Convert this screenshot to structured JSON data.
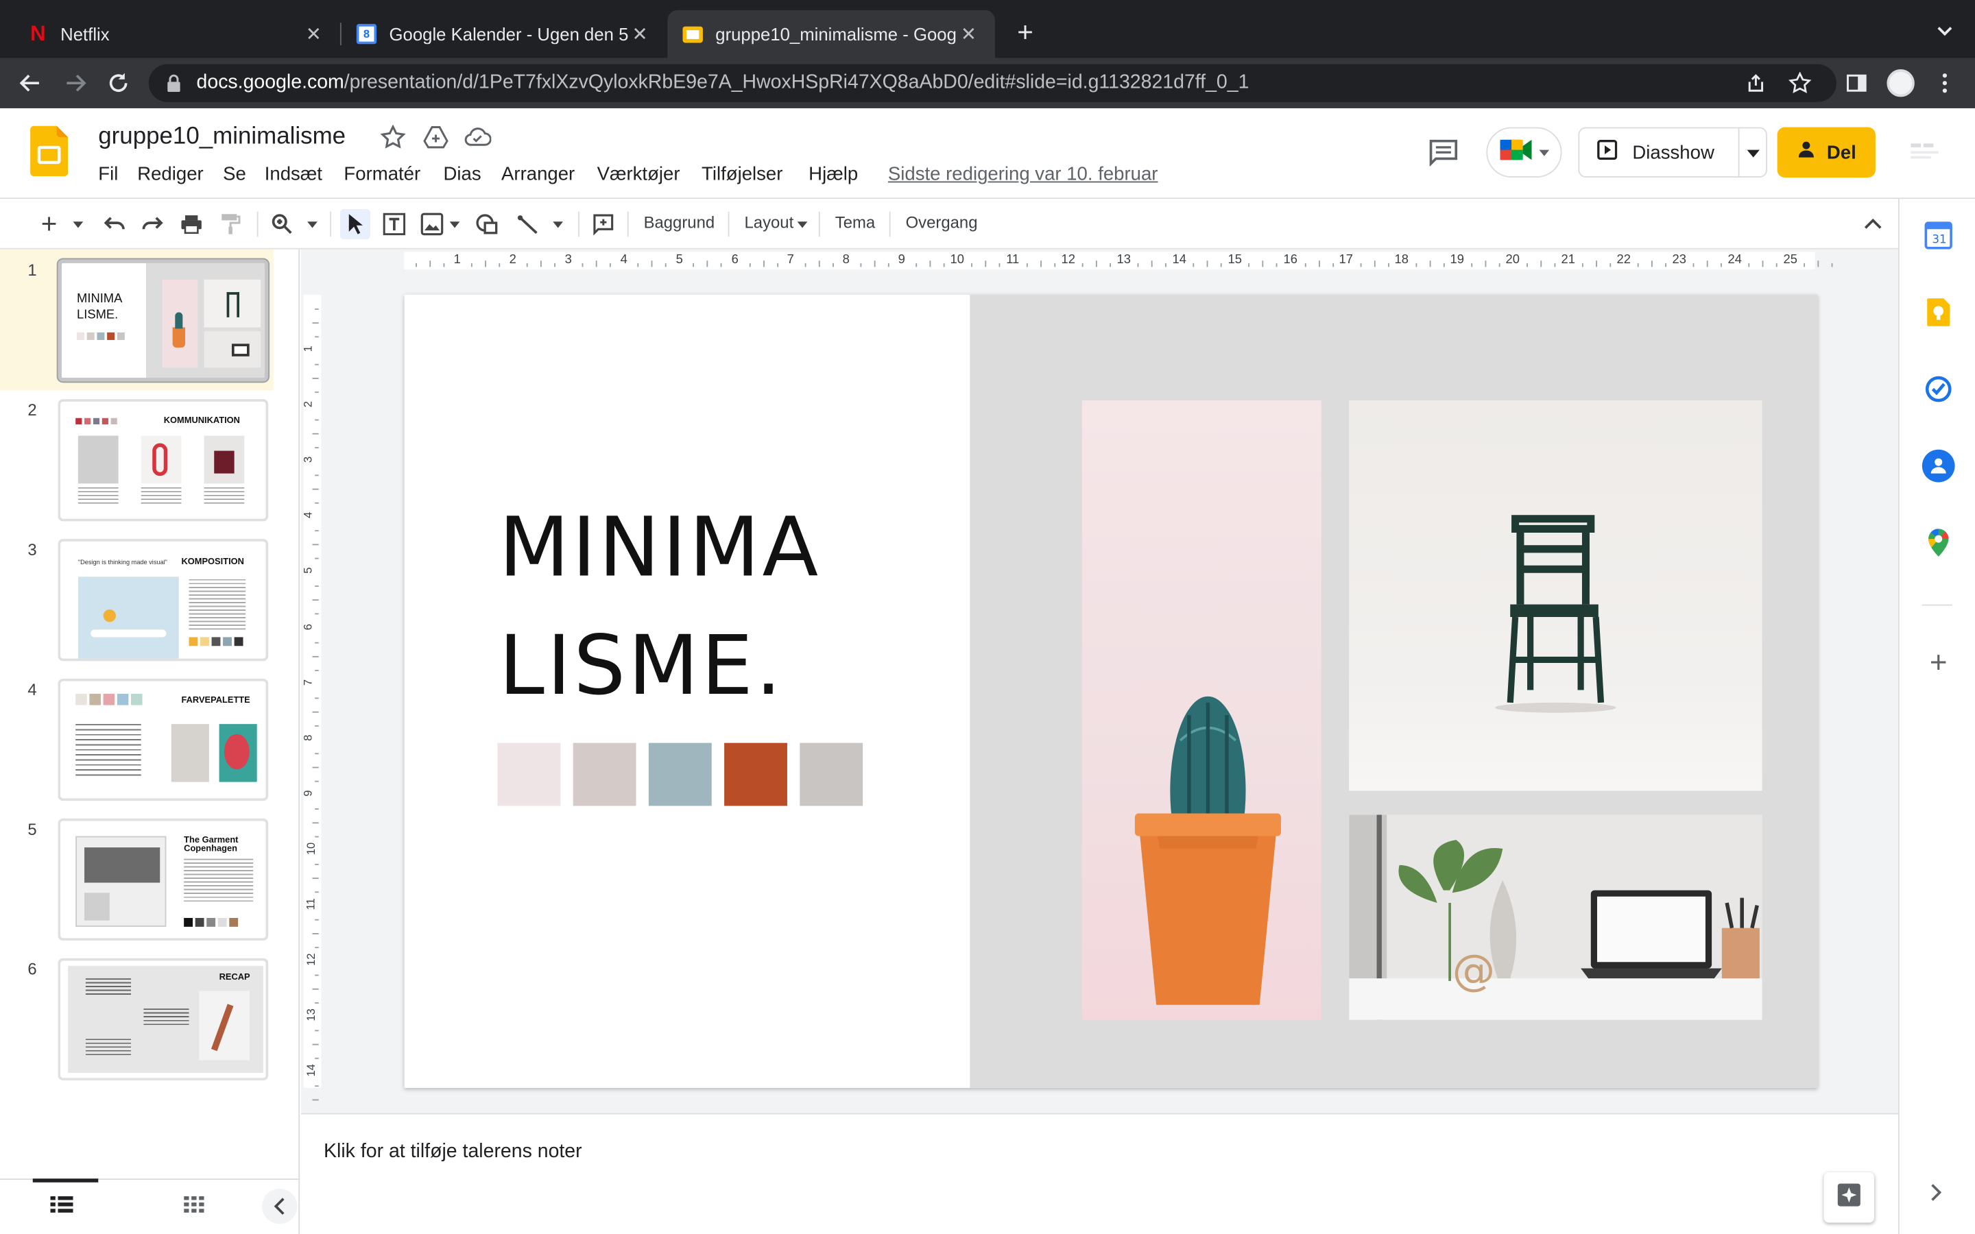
{
  "browser": {
    "tabs": [
      {
        "title": "Netflix",
        "active": false
      },
      {
        "title": "Google Kalender - Ugen den 5.",
        "active": false
      },
      {
        "title": "gruppe10_minimalisme - Googl",
        "active": true
      }
    ],
    "url_host": "docs.google.com",
    "url_path": "/presentation/d/1PeT7fxlXzvQyloxkRbE9e7A_HwoxHSpRi47XQ8aAbD0/edit#slide=id.g1132821d7ff_0_1"
  },
  "docs": {
    "title": "gruppe10_minimalisme",
    "menu": [
      "Fil",
      "Rediger",
      "Se",
      "Indsæt",
      "Formatér",
      "Dias",
      "Arranger",
      "Værktøjer",
      "Tilføjelser",
      "Hjælp"
    ],
    "last_edit": "Sidste redigering var 10. februar",
    "slideshow_label": "Diasshow",
    "share_label": "Del"
  },
  "toolbar": {
    "background_label": "Baggrund",
    "layout_label": "Layout",
    "theme_label": "Tema",
    "transition_label": "Overgang"
  },
  "ruler": {
    "h": [
      "1",
      "2",
      "3",
      "4",
      "5",
      "6",
      "7",
      "8",
      "9",
      "10",
      "11",
      "12",
      "13",
      "14",
      "15",
      "16",
      "17",
      "18",
      "19",
      "20",
      "21",
      "22",
      "23",
      "24",
      "25"
    ],
    "v": [
      "1",
      "2",
      "3",
      "4",
      "5",
      "6",
      "7",
      "8",
      "9",
      "10",
      "11",
      "12",
      "13",
      "14"
    ]
  },
  "filmstrip": [
    {
      "num": "1",
      "title": "MINIMA LISME."
    },
    {
      "num": "2",
      "title": "KOMMUNIKATION"
    },
    {
      "num": "3",
      "title": "KOMPOSITION",
      "quote": "\"Design is thinking made visual\""
    },
    {
      "num": "4",
      "title": "FARVEPALETTE"
    },
    {
      "num": "5",
      "title": "The Garment Copenhagen"
    },
    {
      "num": "6",
      "title": "RECAP"
    }
  ],
  "slide": {
    "title_line1": "MINIMA",
    "title_line2": "LISME.",
    "swatches": [
      "#efe4e5",
      "#d4cbc8",
      "#9fb6be",
      "#b94d27",
      "#c8c5c2"
    ]
  },
  "notes_placeholder": "Klik for at tilføje talerens noter",
  "colors": {
    "accent": "#fbbc04",
    "chrome_dark": "#202124"
  }
}
